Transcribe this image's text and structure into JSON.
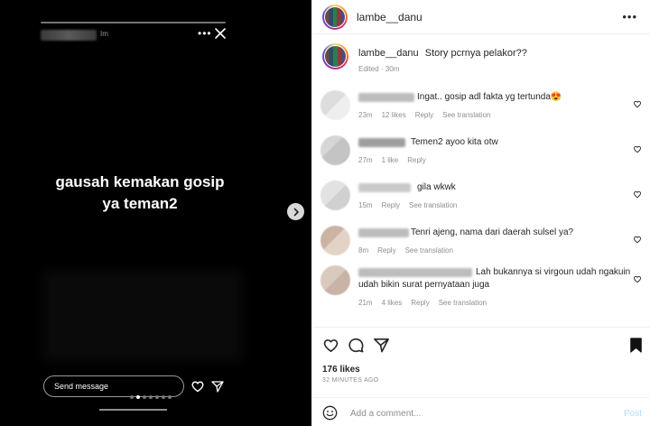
{
  "story": {
    "time": "Im",
    "text_line1": "gausah kemakan gosip",
    "text_line2": "ya teman2",
    "send_placeholder": "Send message",
    "dots": 7,
    "active_dot": 1
  },
  "header": {
    "username": "lambe__danu"
  },
  "caption": {
    "username": "lambe__danu",
    "text": "Story pcrnya pelakor??",
    "meta": "Edited · 30m"
  },
  "comments": [
    {
      "text": "Ingat.. gosip adl fakta yg tertunda😍",
      "time": "23m",
      "likes": "12 likes",
      "reply": "Reply",
      "translation": "See translation"
    },
    {
      "text": "Temen2 ayoo kita otw",
      "time": "27m",
      "likes": "1 like",
      "reply": "Reply",
      "translation": ""
    },
    {
      "text": "gila wkwk",
      "time": "15m",
      "likes": "",
      "reply": "Reply",
      "translation": "See translation"
    },
    {
      "text": "Tenri ajeng, nama dari daerah sulsel ya?",
      "time": "8m",
      "likes": "",
      "reply": "Reply",
      "translation": "See translation"
    },
    {
      "text_line1": "Lah bukannya si virgoun udah ngakuin",
      "text_line2": "udah bikin surat pernyataan juga",
      "time": "21m",
      "likes": "4 likes",
      "reply": "Reply",
      "translation": "See translation"
    }
  ],
  "actions": {
    "likes": "176 likes",
    "ago": "32 MINUTES AGO",
    "add_comment_placeholder": "Add a comment...",
    "post_label": "Post"
  },
  "colors": {
    "story_bg": "#000000",
    "panel_bg": "#ffffff",
    "muted": "#8e8e8e",
    "text": "#262626",
    "post_disabled": "#b3dbff"
  }
}
